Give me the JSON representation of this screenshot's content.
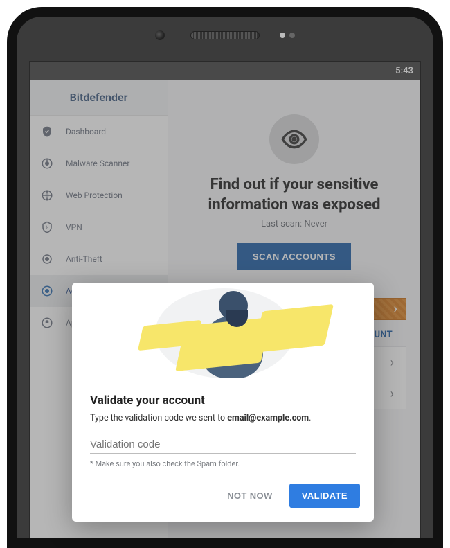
{
  "status": {
    "time": "5:43"
  },
  "brand": "Bitdefender",
  "sidebar": {
    "items": [
      {
        "label": "Dashboard"
      },
      {
        "label": "Malware Scanner"
      },
      {
        "label": "Web Protection"
      },
      {
        "label": "VPN"
      },
      {
        "label": "Anti-Theft"
      },
      {
        "label": "Acc"
      },
      {
        "label": "App"
      }
    ]
  },
  "main": {
    "headline": "Find out if your sensitive information was exposed",
    "lastscan": "Last scan: Never",
    "scan_button": "SCAN ACCOUNTS",
    "account_link": "ACCOUNT",
    "chevron": "›"
  },
  "modal": {
    "title": "Validate your account",
    "instruction_prefix": "Type the validation code we sent to ",
    "email": "email@example.com",
    "instruction_suffix": ".",
    "placeholder": "Validation code",
    "hint": "* Make sure you also check the Spam folder.",
    "not_now": "NOT NOW",
    "validate": "VALIDATE"
  }
}
